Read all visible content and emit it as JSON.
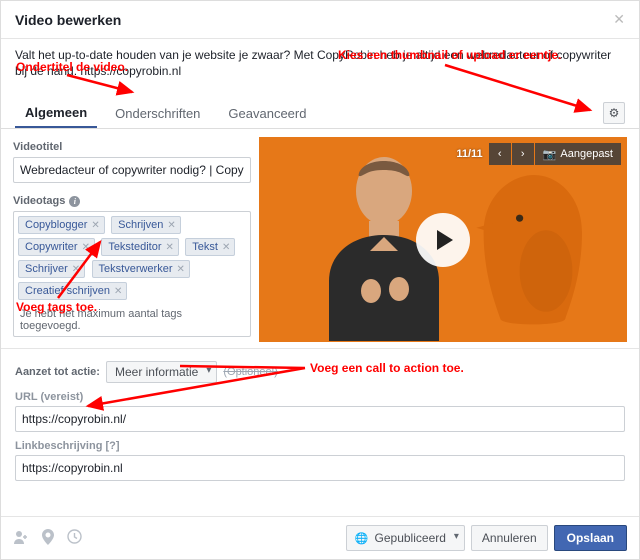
{
  "header": {
    "title": "Video bewerken"
  },
  "description": "Valt het up-to-date houden van je website je zwaar? Met CopyRobin heb je altijd een webredacteur of copywriter bij de hand. https://copyrobin.nl",
  "tabs": {
    "list": [
      "Algemeen",
      "Onderschriften",
      "Geavanceerd"
    ],
    "active": 0
  },
  "left": {
    "title_label": "Videotitel",
    "title_value": "Webredacteur of copywriter nodig? | CopyRo",
    "tags_label": "Videotags",
    "tags": [
      "Copyblogger",
      "Schrijven",
      "Copywriter",
      "Teksteditor",
      "Tekst",
      "Schrijver",
      "Tekstverwerker",
      "Creatief schrijven"
    ],
    "tags_hint": "Je hebt het maximum aantal tags toegevoegd."
  },
  "preview": {
    "counter": "11/11",
    "custom_label": "Aangepast"
  },
  "cta": {
    "label": "Aanzet tot actie:",
    "selected": "Meer informatie",
    "optional": "(Optioneel)",
    "url_label": "URL (vereist)",
    "url_value": "https://copyrobin.nl/",
    "linkdesc_label": "Linkbeschrijving [?]",
    "linkdesc_value": "https://copyrobin.nl"
  },
  "footer": {
    "publish": "Gepubliceerd",
    "cancel": "Annuleren",
    "save": "Opslaan"
  },
  "annotations": {
    "a1": "Ondertitel de video.",
    "a2": "Kies een thumbnail of upload er eentje.",
    "a3": "Voeg tags toe.",
    "a4": "Voeg een call to action toe."
  }
}
